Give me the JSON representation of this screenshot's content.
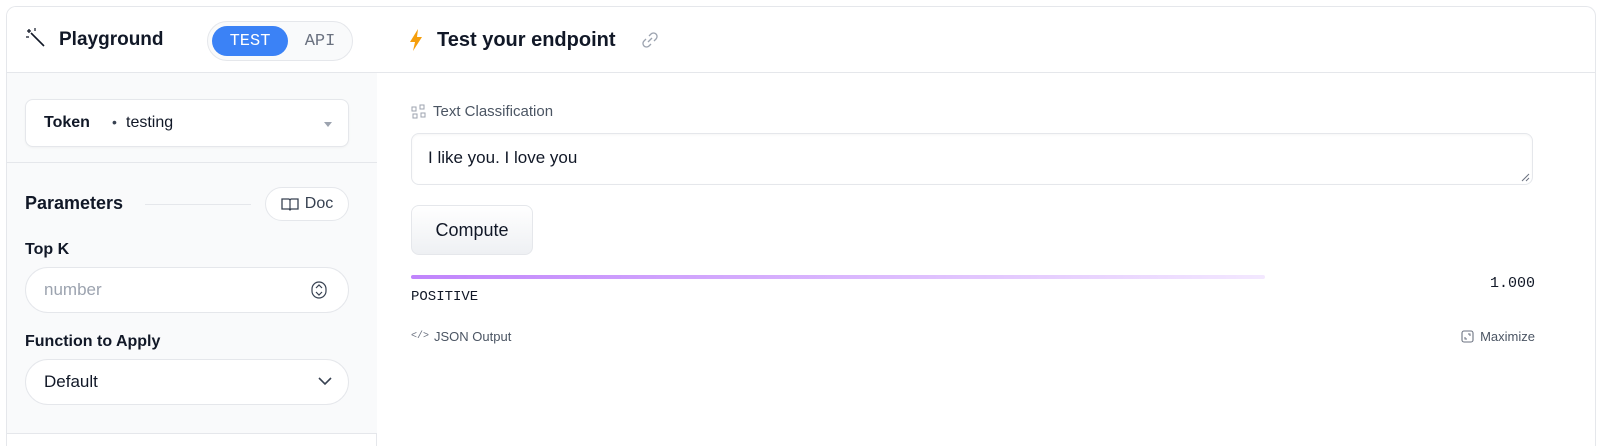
{
  "sidebar": {
    "title": "Playground",
    "mode_toggle": {
      "active": "TEST",
      "inactive": "API"
    },
    "token": {
      "label": "Token",
      "separator": "•",
      "value": "testing"
    },
    "parameters": {
      "title": "Parameters",
      "doc_label": "Doc",
      "top_k": {
        "label": "Top K",
        "placeholder": "number"
      },
      "function_to_apply": {
        "label": "Function to Apply",
        "value": "Default"
      }
    }
  },
  "main": {
    "title": "Test your endpoint",
    "task_label": "Text Classification",
    "input_text": "I like you. I love you",
    "compute_label": "Compute",
    "result": {
      "label": "POSITIVE",
      "score": "1.000",
      "fraction": 1.0
    },
    "json_output_label": "JSON Output",
    "maximize_label": "Maximize"
  },
  "colors": {
    "accent": "#3b82f6",
    "bar_start": "#c084fc",
    "bar_end": "#f3e8ff",
    "bolt": "#f59e0b"
  },
  "icons": [
    "magic-wand-icon",
    "caret-down-icon",
    "book-icon",
    "stepper-icon",
    "chevron-down-icon",
    "bolt-icon",
    "link-icon",
    "classification-icon",
    "resize-handle-icon",
    "code-icon",
    "maximize-icon"
  ]
}
